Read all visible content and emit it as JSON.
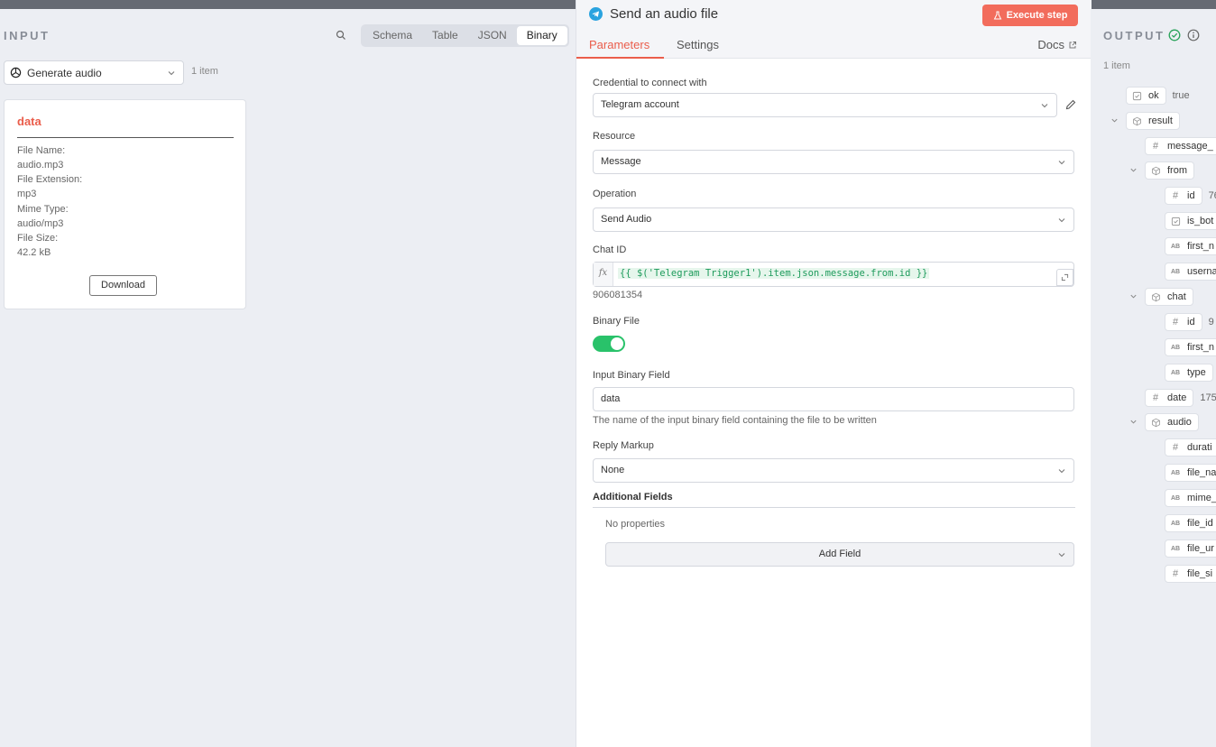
{
  "input": {
    "title": "INPUT",
    "tabs": [
      "Schema",
      "Table",
      "JSON",
      "Binary"
    ],
    "active_tab": "Binary",
    "node_select": "Generate audio",
    "item_count": "1 item",
    "binary": {
      "title": "data",
      "rows": [
        {
          "label": "File Name:",
          "value": "audio.mp3"
        },
        {
          "label": "File Extension:",
          "value": "mp3"
        },
        {
          "label": "Mime Type:",
          "value": "audio/mp3"
        },
        {
          "label": "File Size:",
          "value": "42.2 kB"
        }
      ],
      "download": "Download"
    }
  },
  "node": {
    "title": "Send an audio file",
    "execute": "Execute step",
    "tabs": {
      "parameters": "Parameters",
      "settings": "Settings"
    },
    "docs": "Docs",
    "fields": {
      "credential_label": "Credential to connect with",
      "credential_value": "Telegram account",
      "resource_label": "Resource",
      "resource_value": "Message",
      "operation_label": "Operation",
      "operation_value": "Send Audio",
      "chat_label": "Chat ID",
      "chat_fx": "fx",
      "chat_expr": "{{ $('Telegram Trigger1').item.json.message.from.id }}",
      "chat_preview": "906081354",
      "binary_label": "Binary File",
      "binary_on": true,
      "input_binary_label": "Input Binary Field",
      "input_binary_value": "data",
      "input_binary_hint": "The name of the input binary field containing the file to be written",
      "reply_label": "Reply Markup",
      "reply_value": "None",
      "additional_label": "Additional Fields",
      "no_props": "No properties",
      "add_field": "Add Field"
    }
  },
  "output": {
    "title": "OUTPUT",
    "item_count": "1 item",
    "tree": [
      {
        "key": "ok",
        "type": "bool",
        "value": "true"
      },
      {
        "key": "result",
        "type": "object",
        "value": ""
      },
      {
        "key": "message_",
        "type": "number",
        "value": ""
      },
      {
        "key": "from",
        "type": "object",
        "value": ""
      },
      {
        "key": "id",
        "type": "number",
        "value": "76"
      },
      {
        "key": "is_bot",
        "type": "bool",
        "value": ""
      },
      {
        "key": "first_n",
        "type": "string",
        "value": ""
      },
      {
        "key": "userna",
        "type": "string",
        "value": ""
      },
      {
        "key": "chat",
        "type": "object",
        "value": ""
      },
      {
        "key": "id",
        "type": "number",
        "value": "9"
      },
      {
        "key": "first_n",
        "type": "string",
        "value": ""
      },
      {
        "key": "type",
        "type": "string",
        "value": ""
      },
      {
        "key": "date",
        "type": "number",
        "value": "175"
      },
      {
        "key": "audio",
        "type": "object",
        "value": ""
      },
      {
        "key": "durati",
        "type": "number",
        "value": ""
      },
      {
        "key": "file_na",
        "type": "string",
        "value": ""
      },
      {
        "key": "mime_",
        "type": "string",
        "value": ""
      },
      {
        "key": "file_id",
        "type": "string",
        "value": ""
      },
      {
        "key": "file_ur",
        "type": "string",
        "value": ""
      },
      {
        "key": "file_si",
        "type": "number",
        "value": ""
      }
    ]
  },
  "colors": {
    "accent": "#ea5d4b",
    "execute": "#f26c5c",
    "toggle": "#29c26a",
    "telegram": "#2aa3df",
    "expr": "#1e9b5c"
  }
}
